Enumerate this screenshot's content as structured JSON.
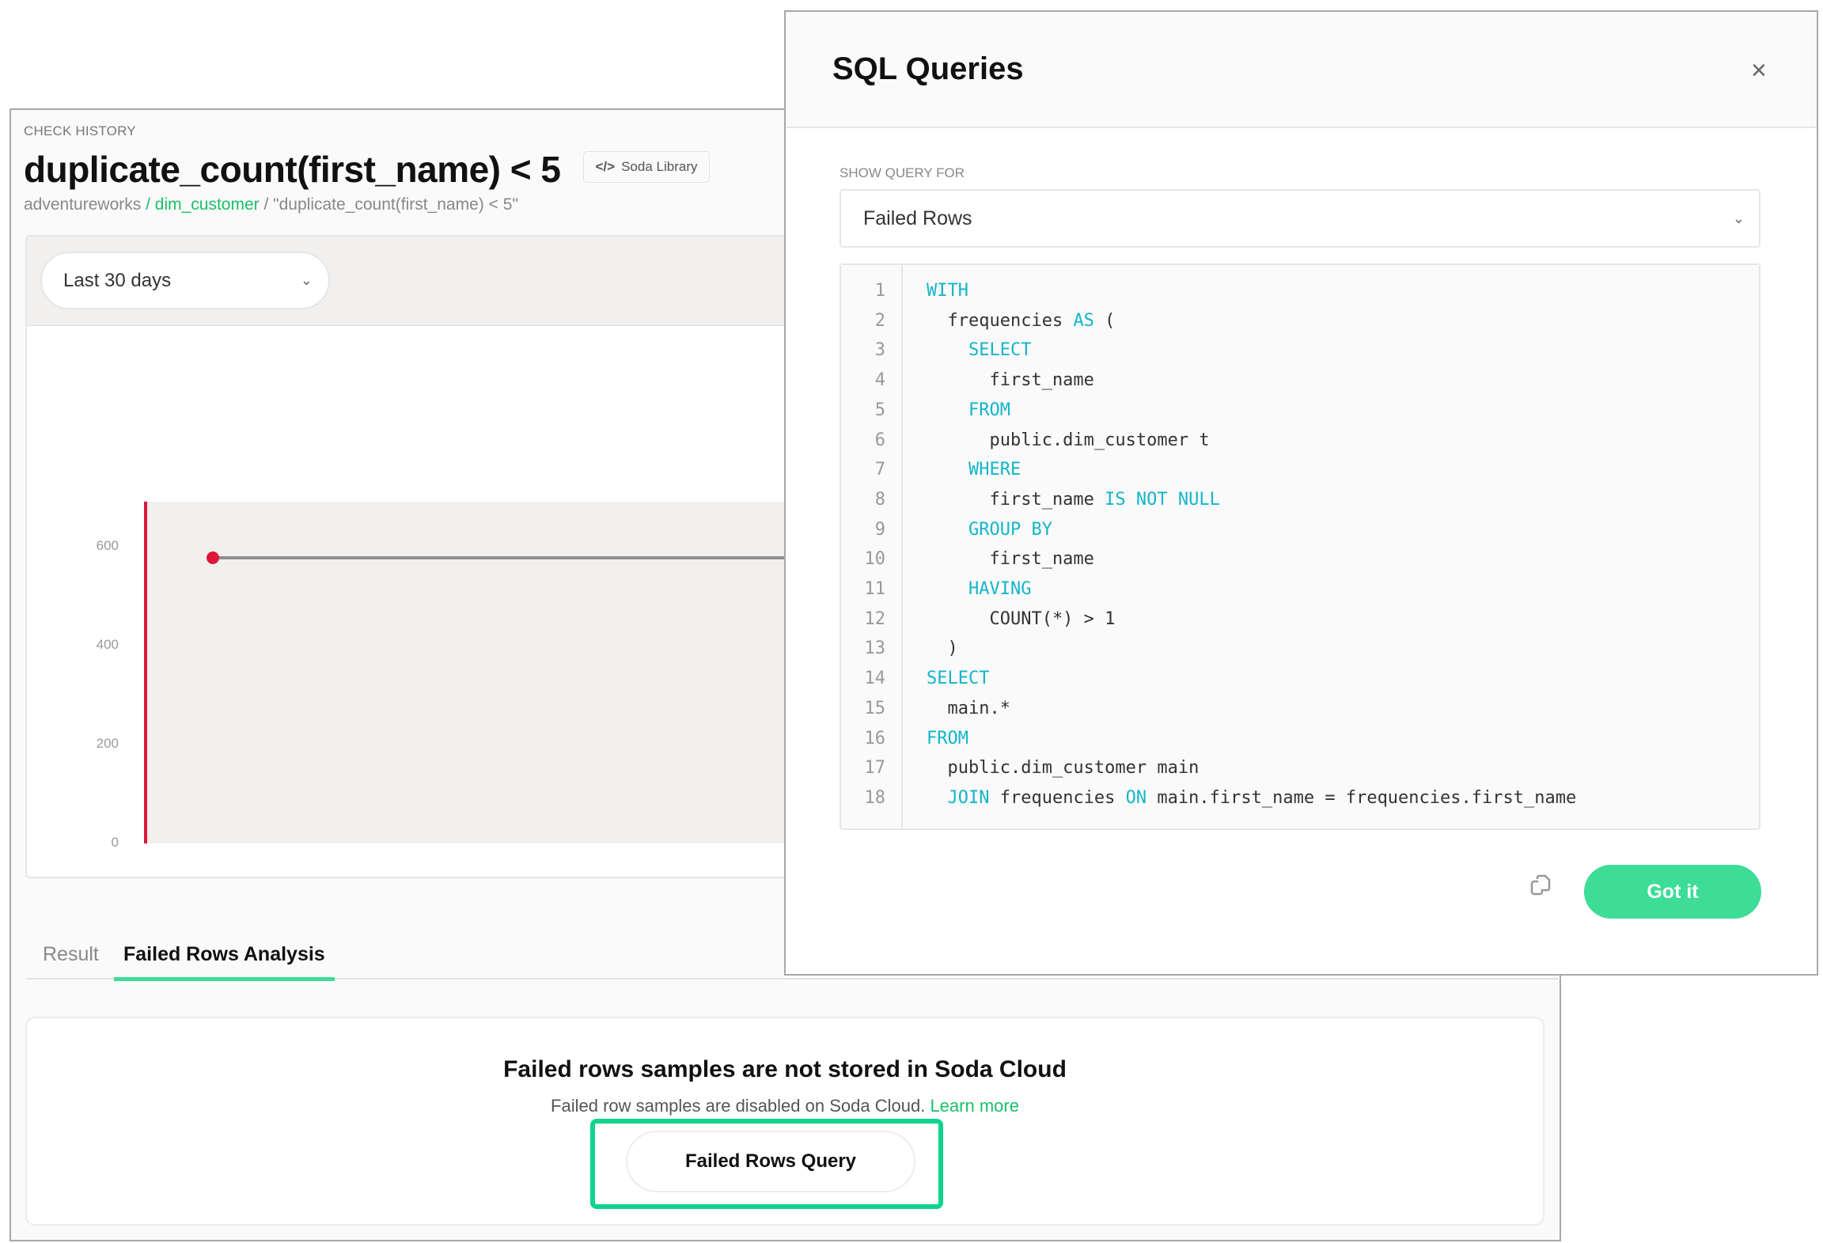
{
  "check": {
    "section_label": "CHECK HISTORY",
    "title": "duplicate_count(first_name) < 5",
    "badge": "Soda Library",
    "breadcrumb": {
      "datasource": "adventureworks",
      "sep1": " / ",
      "dataset": "dim_customer",
      "sep2": " / ",
      "check": "\"duplicate_count(first_name) < 5\""
    },
    "range_select": "Last 30 days"
  },
  "chart_data": {
    "type": "line",
    "title": "",
    "xlabel": "",
    "ylabel": "",
    "yticks": [
      "0",
      "200",
      "400",
      "600"
    ],
    "ylim": [
      0,
      690
    ],
    "series": [
      {
        "name": "duplicate_count",
        "values": [
          577
        ],
        "status": "fail"
      }
    ],
    "colors": {
      "point": "#e0163a",
      "line": "#8f8f8f",
      "fail_marker": "#e0163a"
    }
  },
  "tabs": [
    {
      "label": "Result"
    },
    {
      "label": "Failed Rows Analysis",
      "active": true
    }
  ],
  "failed_rows": {
    "heading": "Failed rows samples are not stored in Soda Cloud",
    "text": "Failed row samples are disabled on Soda Cloud.",
    "link": "Learn more",
    "button": "Failed Rows Query"
  },
  "modal": {
    "title": "SQL Queries",
    "close": "×",
    "select_label": "SHOW QUERY FOR",
    "select_value": "Failed Rows",
    "code": [
      [
        [
          "WITH",
          "k"
        ]
      ],
      [
        [
          "  frequencies ",
          ""
        ],
        [
          "AS",
          "k"
        ],
        [
          " (",
          ""
        ]
      ],
      [
        [
          "    ",
          ""
        ],
        [
          "SELECT",
          "k"
        ]
      ],
      [
        [
          "      first_name",
          ""
        ]
      ],
      [
        [
          "    ",
          ""
        ],
        [
          "FROM",
          "k"
        ]
      ],
      [
        [
          "      public.dim_customer t",
          ""
        ]
      ],
      [
        [
          "    ",
          ""
        ],
        [
          "WHERE",
          "k"
        ]
      ],
      [
        [
          "      first_name ",
          ""
        ],
        [
          "IS NOT NULL",
          "k"
        ]
      ],
      [
        [
          "    ",
          ""
        ],
        [
          "GROUP BY",
          "k"
        ]
      ],
      [
        [
          "      first_name",
          ""
        ]
      ],
      [
        [
          "    ",
          ""
        ],
        [
          "HAVING",
          "k"
        ]
      ],
      [
        [
          "      COUNT(*) > 1",
          ""
        ]
      ],
      [
        [
          "  )",
          ""
        ]
      ],
      [
        [
          "SELECT",
          "k"
        ]
      ],
      [
        [
          "  main.*",
          ""
        ]
      ],
      [
        [
          "FROM",
          "k"
        ]
      ],
      [
        [
          "  public.dim_customer main",
          ""
        ]
      ],
      [
        [
          "  ",
          ""
        ],
        [
          "JOIN",
          "k"
        ],
        [
          " frequencies ",
          ""
        ],
        [
          "ON",
          "k"
        ],
        [
          " main.first_name = frequencies.first_name",
          ""
        ]
      ]
    ],
    "confirm": "Got it"
  },
  "colors": {
    "accent": "#3ddc97",
    "link": "#1bbf6b",
    "keyword": "#13b5c9",
    "fail": "#e0163a"
  }
}
